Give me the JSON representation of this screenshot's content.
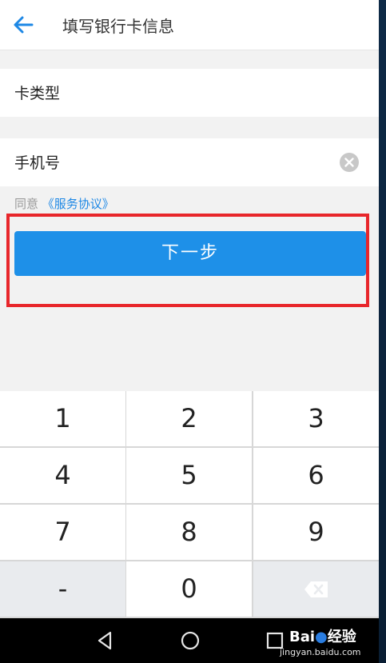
{
  "header": {
    "title": "填写银行卡信息",
    "back_icon": "arrow-left-icon"
  },
  "form": {
    "card_type_label": "卡类型",
    "phone_label": "手机号",
    "clear_icon": "clear-circle-icon"
  },
  "agreement": {
    "prefix": "同意",
    "link": "《服务协议》"
  },
  "next_button": {
    "label": "下一步",
    "color": "#1e90e8"
  },
  "highlight_color": "#e8262b",
  "keypad": {
    "keys": [
      [
        "1",
        "2",
        "3"
      ],
      [
        "4",
        "5",
        "6"
      ],
      [
        "7",
        "8",
        "9"
      ],
      [
        "-",
        "0",
        ""
      ]
    ],
    "backspace_icon": "backspace-icon"
  },
  "navbar": {
    "icons": [
      "nav-back-icon",
      "nav-home-icon",
      "nav-recents-icon"
    ]
  },
  "watermark": {
    "logo_prefix": "Bai",
    "logo_suffix": "经验",
    "url": "jingyan.baidu.com"
  }
}
